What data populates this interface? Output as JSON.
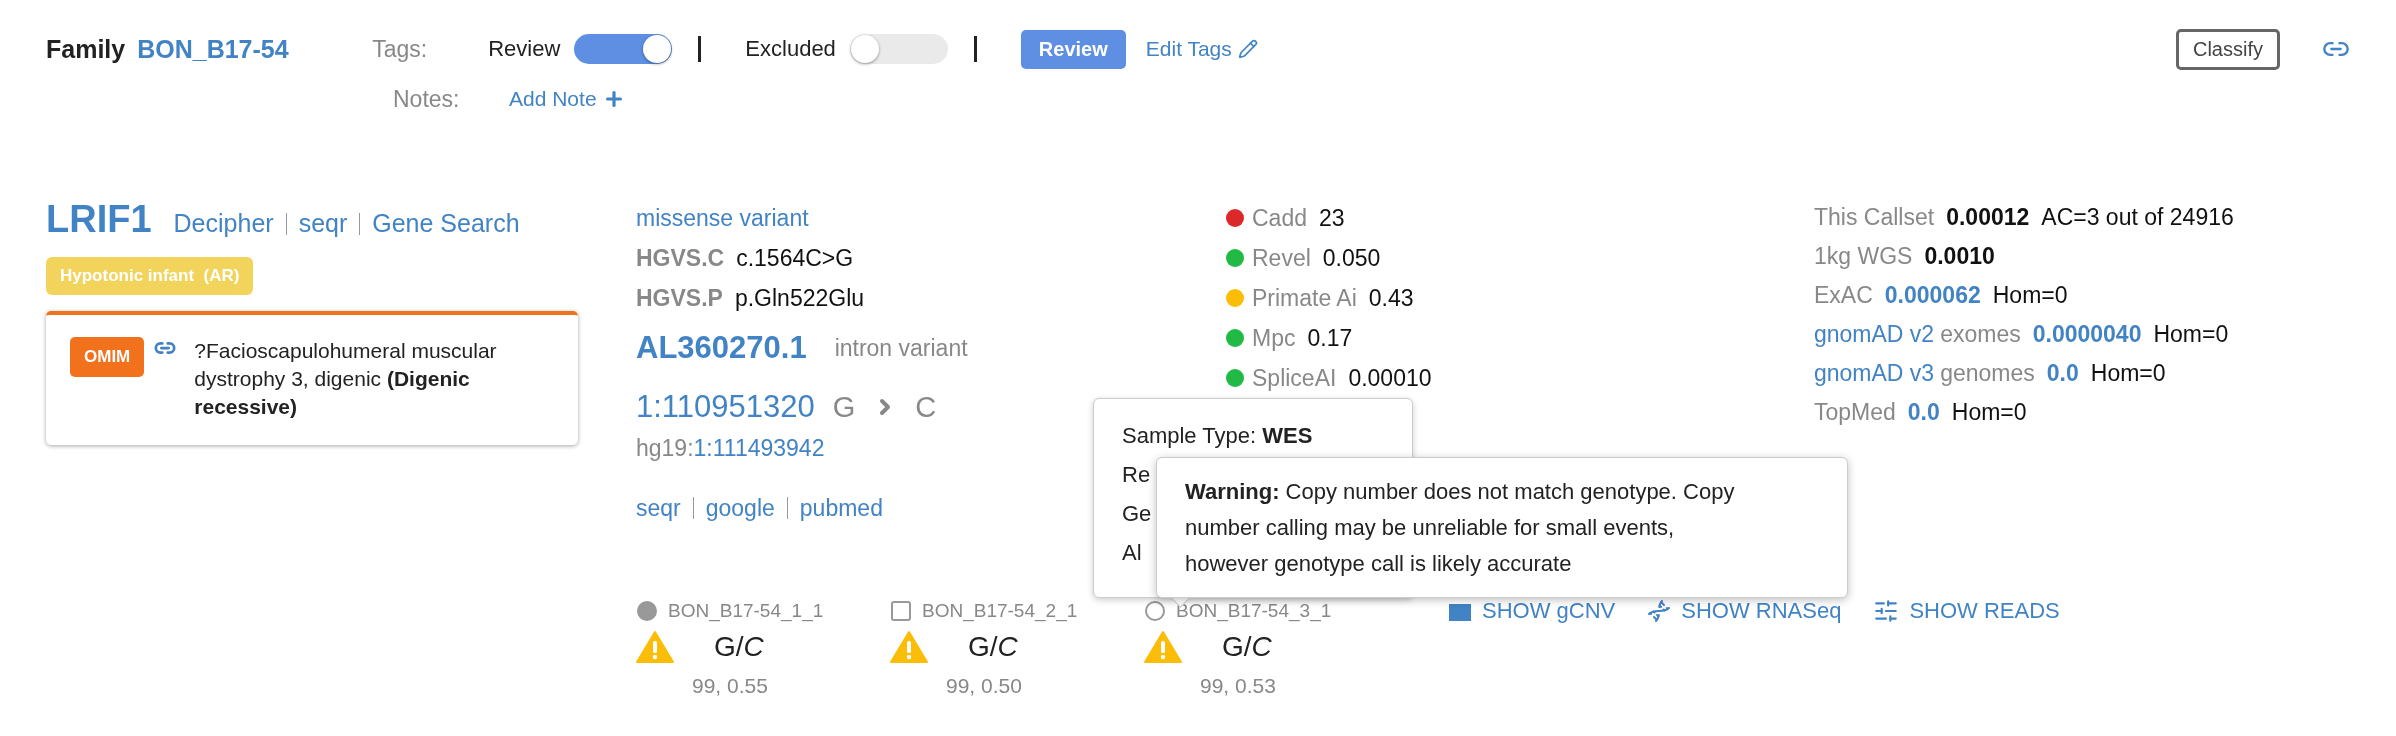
{
  "family": {
    "label": "Family",
    "name": "BON_B17-54"
  },
  "tags": {
    "label": "Tags:",
    "toggles": [
      {
        "label": "Review",
        "on": true
      },
      {
        "label": "Excluded",
        "on": false
      }
    ],
    "tag_button": "Review",
    "edit": "Edit Tags"
  },
  "notes": {
    "label": "Notes:",
    "add": "Add Note"
  },
  "classify": "Classify",
  "gene": {
    "symbol": "LRIF1",
    "links": [
      "Decipher",
      "seqr",
      "Gene Search"
    ],
    "panel_tag": "Hypotonic infant  (AR)",
    "omim": {
      "badge": "OMIM",
      "text": "?Facioscapulohumeral muscular dystrophy 3, digenic **(Digenic recessive)**"
    }
  },
  "annotation": {
    "consequence": "missense variant",
    "hgvs": [
      {
        "label": "HGVS.C",
        "value": "c.1564C>G"
      },
      {
        "label": "HGVS.P",
        "value": "p.Gln522Glu"
      }
    ],
    "other_gene": "AL360270.1",
    "other_consequence": "intron variant",
    "position": "1:110951320",
    "ref": "G",
    "alt": "C",
    "hg19_label": "hg19:",
    "hg19": "1:111493942",
    "links": [
      "seqr",
      "google",
      "pubmed"
    ]
  },
  "scores": [
    {
      "label": "Cadd",
      "value": "23",
      "color": "#db2828"
    },
    {
      "label": "Revel",
      "value": "0.050",
      "color": "#21ba45"
    },
    {
      "label": "Primate Ai",
      "value": "0.43",
      "color": "#fbbd08"
    },
    {
      "label": "Mpc",
      "value": "0.17",
      "color": "#21ba45"
    },
    {
      "label": "SpliceAI",
      "value": "0.00010",
      "color": "#21ba45"
    }
  ],
  "frequencies": [
    {
      "source": "This Callset",
      "value": "0.00012",
      "linked": false,
      "extra": "AC=3 out of 24916"
    },
    {
      "source": "1kg WGS",
      "value": "0.0010",
      "linked": false
    },
    {
      "source": "ExAC",
      "value": "0.000062",
      "linked": true,
      "extra": "Hom=0"
    },
    {
      "source_link": "gnomAD v2",
      "source": "exomes",
      "value": "0.0000040",
      "linked": true,
      "extra": "Hom=0"
    },
    {
      "source_link": "gnomAD v3",
      "source": "genomes",
      "value": "0.0",
      "linked": true,
      "extra": "Hom=0"
    },
    {
      "source": "TopMed",
      "value": "0.0",
      "linked": true,
      "extra": "Hom=0"
    }
  ],
  "samples": [
    {
      "name": "BON_B17-54_1_1",
      "kind": "circle",
      "affected": true,
      "genotype": "G/*C*",
      "quality": "99, 0.55"
    },
    {
      "name": "BON_B17-54_2_1",
      "kind": "square",
      "affected": false,
      "genotype": "G/*C*",
      "quality": "99, 0.50"
    },
    {
      "name": "BON_B17-54_3_1",
      "kind": "circle",
      "affected": false,
      "genotype": "G/*C*",
      "quality": "99, 0.53"
    }
  ],
  "actions": [
    {
      "kind": "cnv",
      "label": "SHOW gCNV"
    },
    {
      "kind": "rna",
      "label": "SHOW RNASeq"
    },
    {
      "kind": "reads",
      "label": "SHOW READS"
    }
  ],
  "sample_popup": {
    "lines": [
      "Sample Type: **WES**",
      "Re",
      "Ge",
      "Al"
    ]
  },
  "warning_popup": {
    "text": "**Warning:** Copy number does not match genotype. Copy number calling may be unreliable for small events, however genotype call is likely accurate"
  }
}
